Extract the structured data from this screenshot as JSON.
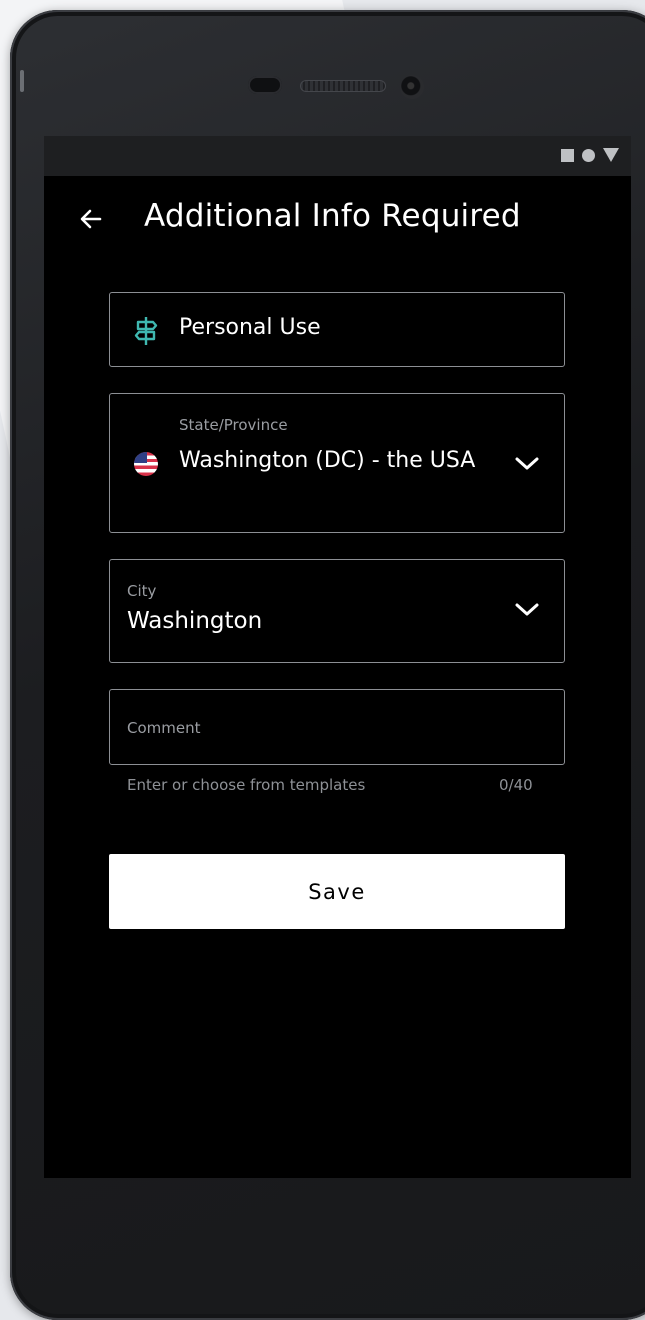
{
  "header": {
    "title": "Additional Info Required",
    "back_icon": "arrow-left-icon"
  },
  "status_bar": {
    "icons": [
      "square-icon",
      "circle-icon",
      "triangle-down-icon"
    ]
  },
  "form": {
    "purpose": {
      "value": "Personal Use",
      "icon": "signpost-icon",
      "icon_color": "#3fb8b0"
    },
    "state": {
      "label": "State/Province",
      "value": "Washington (DC) - the USA",
      "flag": "us-flag-icon"
    },
    "city": {
      "label": "City",
      "value": "Washington"
    },
    "comment": {
      "placeholder": "Comment",
      "value": "",
      "helper": "Enter or choose from templates",
      "counter": "0/40"
    },
    "save_label": "Save"
  },
  "colors": {
    "screen_bg": "#000000",
    "accent": "#3fb8b0",
    "field_border": "#8c8f94",
    "button_bg": "#ffffff"
  }
}
